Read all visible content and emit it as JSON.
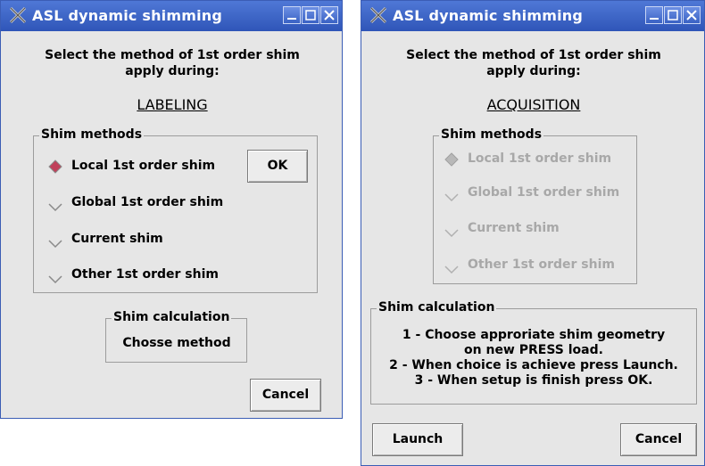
{
  "left_window": {
    "title": "ASL dynamic shimming",
    "prompt_line1": "Select the method of 1st order shim",
    "prompt_line2": "apply during:",
    "phase": "LABELING",
    "shim_methods": {
      "legend": "Shim methods",
      "options": [
        {
          "label": "Local 1st order shim",
          "selected": true
        },
        {
          "label": "Global 1st order shim",
          "selected": false
        },
        {
          "label": "Current shim",
          "selected": false
        },
        {
          "label": "Other 1st order shim",
          "selected": false
        }
      ]
    },
    "ok_label": "OK",
    "shim_calculation": {
      "legend": "Shim calculation",
      "button_label": "Chosse method"
    },
    "cancel_label": "Cancel"
  },
  "right_window": {
    "title": "ASL dynamic shimming",
    "prompt_line1": "Select the method of 1st order shim",
    "prompt_line2": "apply during:",
    "phase": "ACQUISITION",
    "shim_methods": {
      "legend": "Shim methods",
      "options": [
        {
          "label": "Local 1st order shim",
          "selected": true
        },
        {
          "label": "Global 1st order shim",
          "selected": false
        },
        {
          "label": "Current shim",
          "selected": false
        },
        {
          "label": "Other 1st order shim",
          "selected": false
        }
      ]
    },
    "shim_calculation": {
      "legend": "Shim calculation",
      "lines": [
        "1 - Choose approriate shim geometry",
        "on new PRESS load.",
        "2 - When choice is achieve press Launch.",
        "3 - When setup is finish press OK."
      ]
    },
    "launch_label": "Launch",
    "cancel_label": "Cancel"
  },
  "colors": {
    "titlebar": "#3a62c4",
    "window_bg": "#e6e6e6",
    "radio_selected": "#c0405a",
    "disabled_text": "#a8a8a8"
  }
}
